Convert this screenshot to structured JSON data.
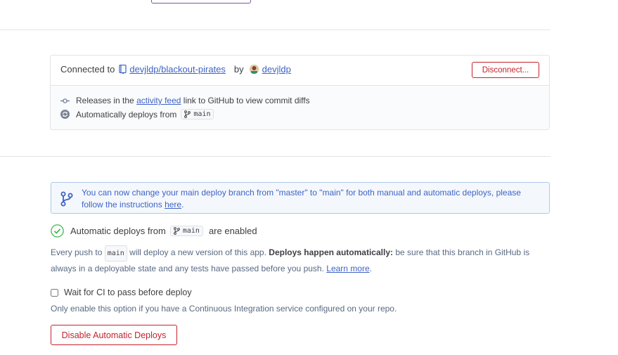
{
  "connection": {
    "prefix": "Connected to",
    "repo": "devjldp/blackout-pirates",
    "by": "by",
    "user": "devjldp",
    "disconnect_label": "Disconnect..."
  },
  "info_lines": {
    "releases_prefix": "Releases in the",
    "activity_feed": "activity feed",
    "releases_suffix": "link to GitHub to view commit diffs",
    "auto_text": "Automatically deploys from",
    "branch": "main"
  },
  "banner": {
    "text": "You can now change your main deploy branch from \"master\" to \"main\" for both manual and automatic deploys, please follow the instructions",
    "link": "here",
    "end": "."
  },
  "auto_deploy": {
    "prefix": "Automatic deploys from",
    "branch": "main",
    "suffix": "are enabled",
    "desc_1": "Every push to",
    "desc_branch": "main",
    "desc_2": "will deploy a new version of this app.",
    "desc_bold": "Deploys happen automatically:",
    "desc_3": "be sure that this branch in GitHub is always in a deployable state and any tests have passed before you push.",
    "learn_more": "Learn more",
    "desc_end": "."
  },
  "ci": {
    "label": "Wait for CI to pass before deploy",
    "checked": false,
    "note": "Only enable this option if you have a Continuous Integration service configured on your repo."
  },
  "disable_label": "Disable Automatic Deploys",
  "colors": {
    "danger": "#c6222b",
    "link": "#3e63c4",
    "success": "#3fb950",
    "banner_bg": "#f4f8fd"
  }
}
